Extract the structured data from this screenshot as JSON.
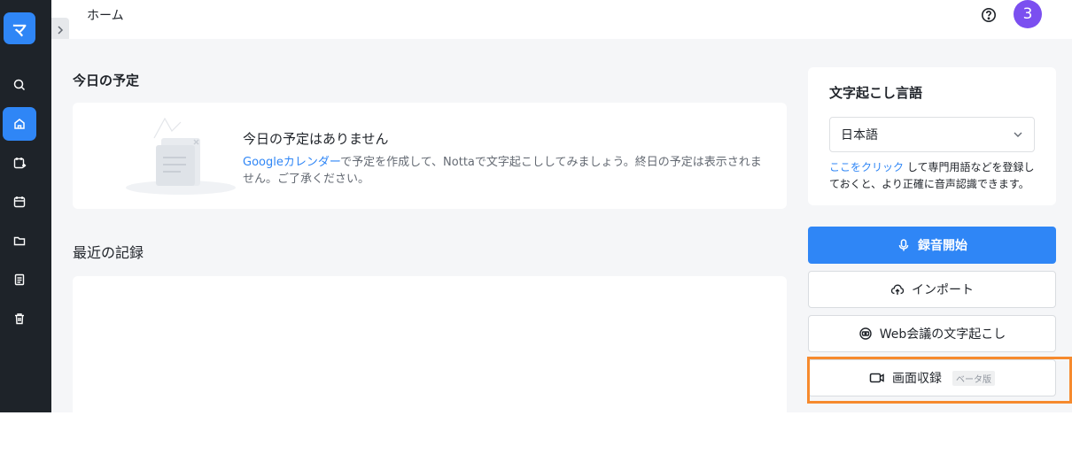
{
  "sidebar": {
    "logo_text": "マ",
    "items": [
      {
        "name": "search",
        "icon": "search-icon",
        "active": false
      },
      {
        "name": "home",
        "icon": "home-icon",
        "active": true
      },
      {
        "name": "schedule-sync",
        "icon": "calendar-sync-icon",
        "active": false
      },
      {
        "name": "calendar",
        "icon": "calendar-icon",
        "active": false
      },
      {
        "name": "folder",
        "icon": "folder-icon",
        "active": false
      },
      {
        "name": "document",
        "icon": "document-icon",
        "active": false
      },
      {
        "name": "trash",
        "icon": "trash-icon",
        "active": false
      }
    ]
  },
  "header": {
    "title": "ホーム",
    "avatar_text": "3"
  },
  "schedule": {
    "title": "今日の予定",
    "empty_title": "今日の予定はありません",
    "desc_link": "Googleカレンダー",
    "desc_text": "で予定を作成して、Nottaで文字起こししてみましょう。終日の予定は表示されません。ご了承ください。"
  },
  "recent": {
    "title": "最近の記録"
  },
  "language": {
    "title": "文字起こし言語",
    "selected": "日本語",
    "note_link": "ここをクリック",
    "note_text": " して専門用語などを登録しておくと、より正確に音声認識できます。"
  },
  "actions": {
    "record": "録音開始",
    "import": "インポート",
    "web_meeting": "Web会議の文字起こし",
    "screen_record": "画面収録",
    "beta": "ベータ版"
  },
  "colors": {
    "accent": "#2f86f6",
    "sidebar_bg": "#1e2329",
    "avatar": "#7b4ff0",
    "highlight": "#f68a2e"
  }
}
